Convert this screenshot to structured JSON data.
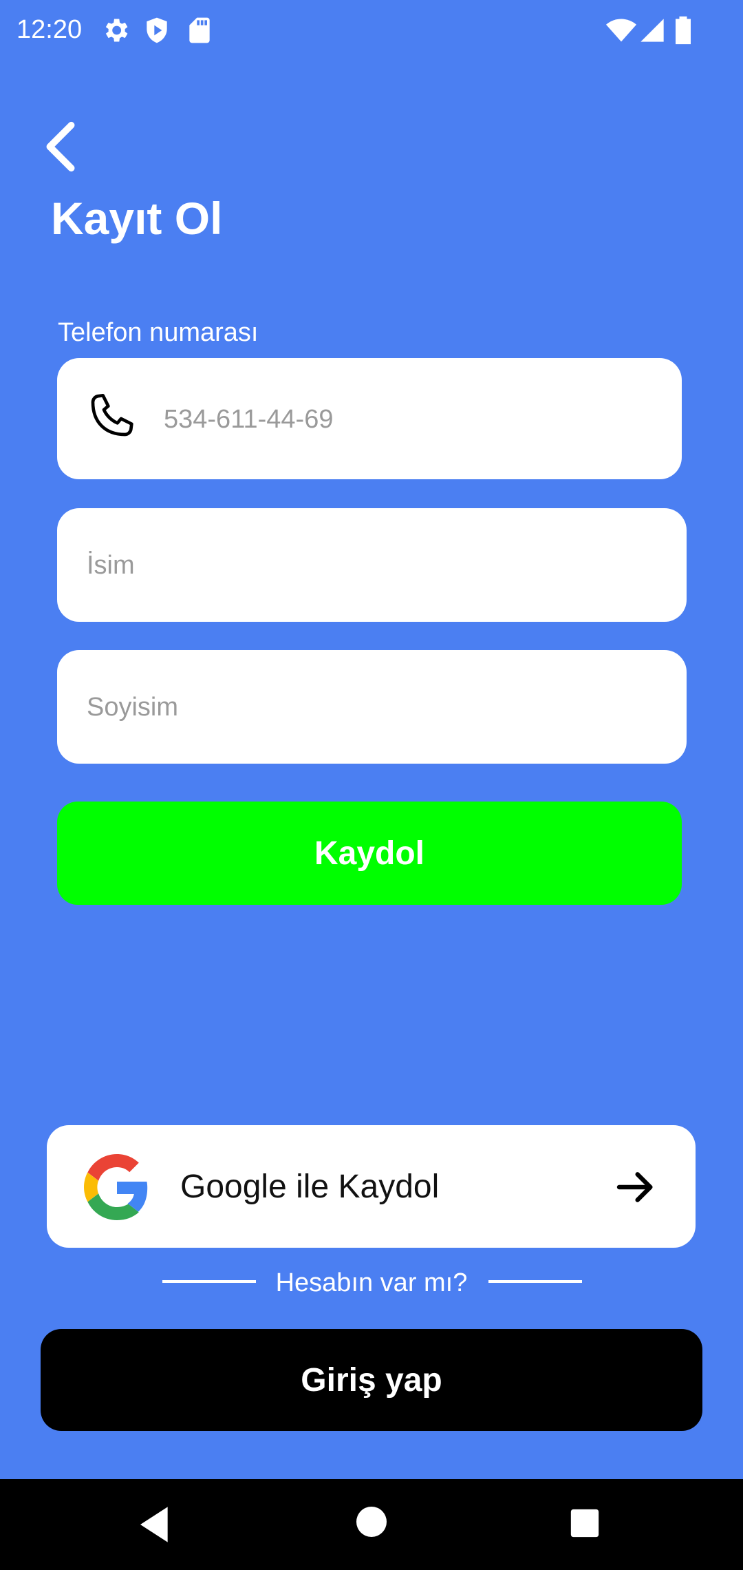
{
  "status_bar": {
    "time": "12:20",
    "icons_left": [
      "settings-icon",
      "shield-play-icon",
      "sd-card-icon"
    ],
    "icons_right": [
      "wifi-icon",
      "signal-icon",
      "battery-icon"
    ]
  },
  "header": {
    "back_icon": "chevron-left-icon",
    "title": "Kayıt Ol"
  },
  "form": {
    "phone_label": "Telefon numarası",
    "phone_placeholder": "534-611-44-69",
    "phone_icon": "phone-icon",
    "name_placeholder": "İsim",
    "surname_placeholder": "Soyisim",
    "register_label": "Kaydol"
  },
  "google": {
    "label": "Google ile Kaydol",
    "logo": "google-logo",
    "arrow_icon": "arrow-right-icon"
  },
  "footer": {
    "have_account": "Hesabın var mı?",
    "login_label": "Giriş yap"
  },
  "colors": {
    "background": "#4b7ff2",
    "register_button": "#00ff00",
    "login_button": "#000000"
  },
  "nav_bar": {
    "icons": [
      "nav-back-icon",
      "nav-home-icon",
      "nav-recent-icon"
    ]
  }
}
